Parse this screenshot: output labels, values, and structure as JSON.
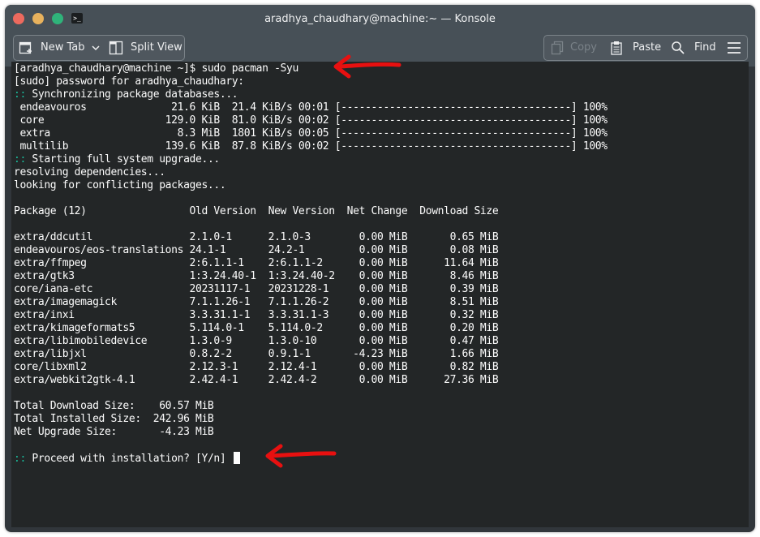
{
  "window": {
    "title": "aradhya_chaudhary@machine:~ — Konsole"
  },
  "toolbar": {
    "new_tab_label": "New Tab",
    "split_view_label": "Split View",
    "copy_label": "Copy",
    "paste_label": "Paste",
    "find_label": "Find"
  },
  "terminal": {
    "prompt": "[aradhya_chaudhary@machine ~]$ ",
    "command": "sudo pacman -Syu",
    "sudo_prompt": "[sudo] password for aradhya_chaudhary:",
    "sync_header": ":: Synchronizing package databases...",
    "sync_rows": [
      " endeavouros              21.6 KiB  21.4 KiB/s 00:01 [--------------------------------------] 100%",
      " core                    129.0 KiB  81.0 KiB/s 00:02 [--------------------------------------] 100%",
      " extra                     8.3 MiB  1801 KiB/s 00:05 [--------------------------------------] 100%",
      " multilib                139.6 KiB  87.8 KiB/s 00:02 [--------------------------------------] 100%"
    ],
    "upgrade_header": ":: Starting full system upgrade...",
    "resolving": "resolving dependencies...",
    "conflicts": "looking for conflicting packages...",
    "table_header": "Package (12)                 Old Version  New Version  Net Change  Download Size",
    "package_rows": [
      "extra/ddcutil                2.1.0-1      2.1.0-3        0.00 MiB       0.65 MiB",
      "endeavouros/eos-translations 24.1-1       24.2-1         0.00 MiB       0.08 MiB",
      "extra/ffmpeg                 2:6.1.1-1    2:6.1.1-2      0.00 MiB      11.64 MiB",
      "extra/gtk3                   1:3.24.40-1  1:3.24.40-2    0.00 MiB       8.46 MiB",
      "core/iana-etc                20231117-1   20231228-1     0.00 MiB       0.39 MiB",
      "extra/imagemagick            7.1.1.26-1   7.1.1.26-2     0.00 MiB       8.51 MiB",
      "extra/inxi                   3.3.31.1-1   3.3.31.1-3     0.00 MiB       0.32 MiB",
      "extra/kimageformats5         5.114.0-1    5.114.0-2      0.00 MiB       0.20 MiB",
      "extra/libimobiledevice       1.3.0-9      1.3.0-10       0.00 MiB       0.47 MiB",
      "extra/libjxl                 0.8.2-2      0.9.1-1       -4.23 MiB       1.66 MiB",
      "core/libxml2                 2.12.3-1     2.12.4-1       0.00 MiB       0.82 MiB",
      "extra/webkit2gtk-4.1         2.42.4-1     2.42.4-2       0.00 MiB      27.36 MiB"
    ],
    "total_download": "Total Download Size:    60.57 MiB",
    "total_installed": "Total Installed Size:  242.96 MiB",
    "net_upgrade": "Net Upgrade Size:       -4.23 MiB",
    "proceed_marker": ":: ",
    "proceed_prompt": "Proceed with installation? [Y/n] "
  },
  "colors": {
    "terminal_bg": "#232627",
    "text": "#fcfcfc",
    "cyan": "#1abc9c",
    "titlebar": "#475057",
    "annotation_arrow": "#e81010"
  }
}
